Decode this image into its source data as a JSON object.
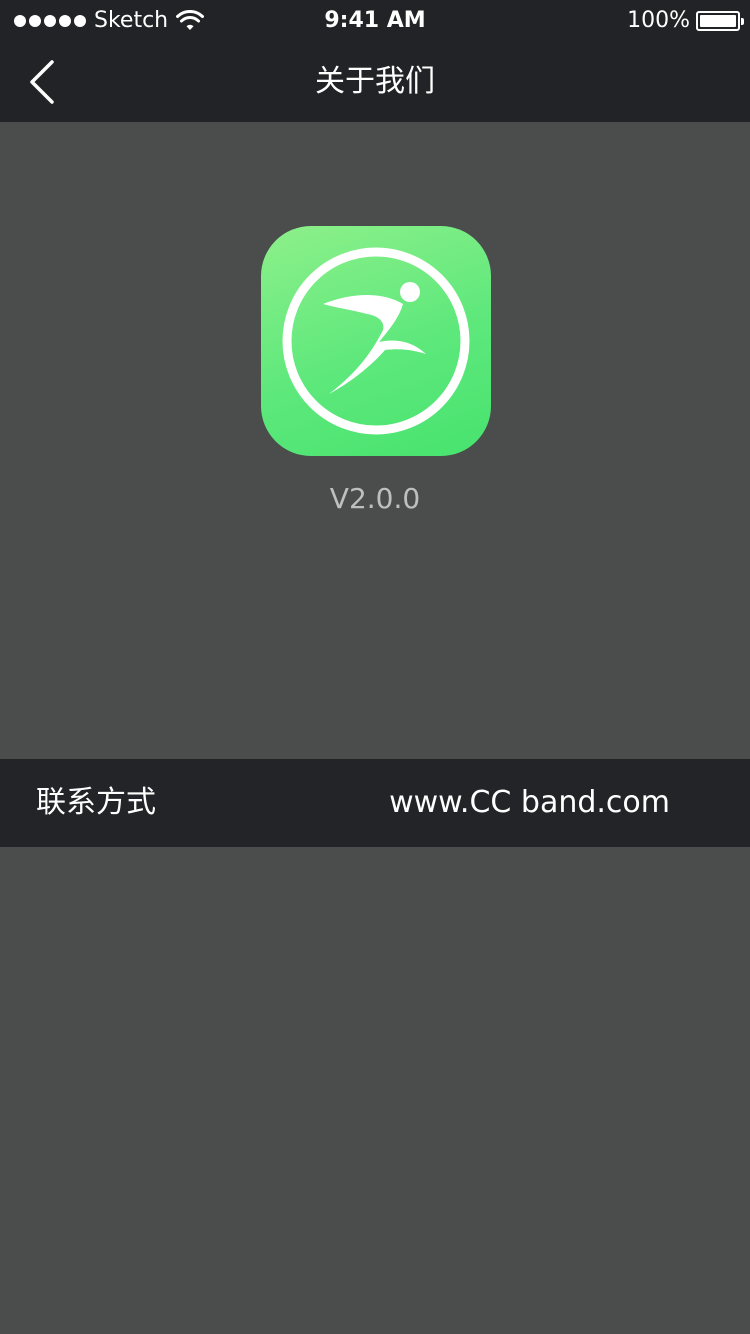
{
  "status_bar": {
    "carrier": "Sketch",
    "time": "9:41 AM",
    "battery_percent": "100%",
    "battery_level": 1.0,
    "signal_icon": "signal-dots-icon",
    "wifi_icon": "wifi-icon",
    "battery_icon": "battery-icon"
  },
  "nav": {
    "title": "关于我们",
    "back_icon": "chevron-left-icon"
  },
  "app": {
    "icon": "runner-logo-icon",
    "version": "V2.0.0"
  },
  "contact": {
    "label": "联系方式",
    "value": "www.CC band.com"
  },
  "colors": {
    "background": "#4b4c4c",
    "bars": "#222326",
    "icon_green_light": "#8ef08a",
    "icon_green_dark": "#47e36e",
    "version_text": "#bfbfbf"
  }
}
